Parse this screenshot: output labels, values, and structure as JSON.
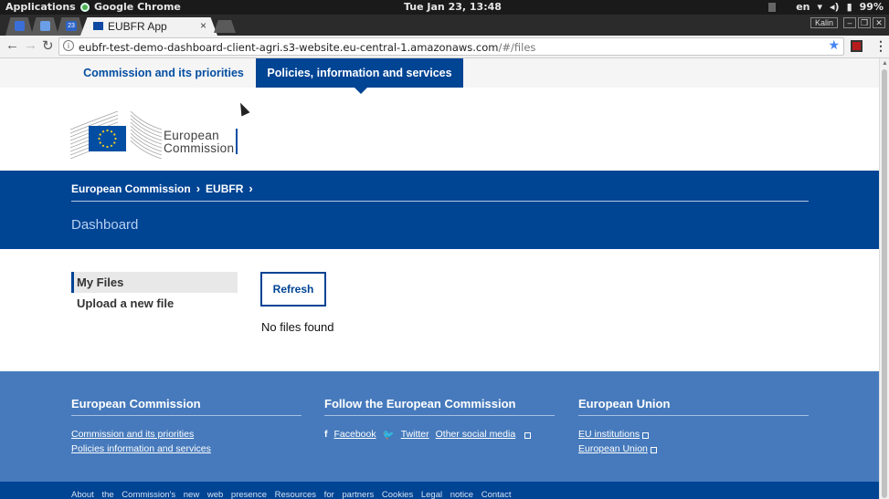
{
  "system_bar": {
    "applications": "Applications",
    "app_name": "Google Chrome",
    "clock": "Tue Jan 23, 13:48",
    "lang": "en",
    "battery": "99%"
  },
  "browser": {
    "tab_title": "EUBFR App",
    "tab_close": "×",
    "profile": "Kalin",
    "mini_tab_date": "23",
    "url_host": "eubfr-test-demo-dashboard-client-agri.s3-website.eu-central-1.amazonaws.com",
    "url_path": "/#/files"
  },
  "topnav": {
    "item1": "Commission and its priorities",
    "item2": "Policies, information and services"
  },
  "logo": {
    "line1": "European",
    "line2": "Commission"
  },
  "hero": {
    "crumb1": "European Commission",
    "crumb2": "EUBFR",
    "title": "Dashboard"
  },
  "sidebar": {
    "items": [
      {
        "label": "My Files"
      },
      {
        "label": "Upload a new file"
      }
    ]
  },
  "main": {
    "refresh_label": "Refresh",
    "empty_text": "No files found"
  },
  "footer": {
    "col1": {
      "title": "European Commission",
      "links": [
        "Commission and its priorities",
        "Policies information and services"
      ]
    },
    "col2": {
      "title": "Follow the European Commission",
      "facebook": "Facebook",
      "twitter": "Twitter",
      "other": "Other social media"
    },
    "col3": {
      "title": "European Union",
      "links": [
        "EU institutions",
        "European Union"
      ]
    },
    "bottom": "About the Commission's new web presence   Resources for partners   Cookies   Legal notice   Contact"
  },
  "colors": {
    "ec_blue": "#004494",
    "footer_blue": "#467abc",
    "link_blue": "#034ea2"
  }
}
